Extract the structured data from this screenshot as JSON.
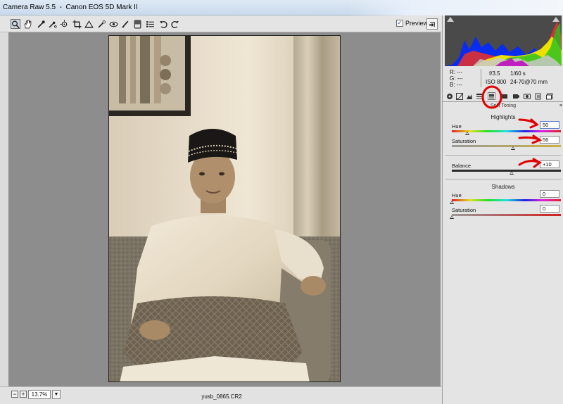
{
  "window": {
    "title": "Camera Raw 5.5  -  Canon EOS 5D Mark II"
  },
  "toolbar": {
    "tools": [
      {
        "name": "zoom-tool-icon",
        "active": true
      },
      {
        "name": "hand-tool-icon"
      },
      {
        "name": "white-balance-tool-icon"
      },
      {
        "name": "color-sampler-tool-icon"
      },
      {
        "name": "targeted-adjustment-tool-icon"
      },
      {
        "name": "crop-tool-icon"
      },
      {
        "name": "straighten-tool-icon"
      },
      {
        "name": "spot-removal-tool-icon"
      },
      {
        "name": "red-eye-removal-tool-icon"
      },
      {
        "name": "adjustment-brush-icon"
      },
      {
        "name": "graduated-filter-icon"
      },
      {
        "name": "preferences-icon"
      },
      {
        "name": "rotate-left-icon"
      },
      {
        "name": "rotate-right-icon"
      }
    ],
    "preview_label": "Preview",
    "preview_checked": true
  },
  "bottombar": {
    "zoom_out": "−",
    "zoom_in": "+",
    "zoom_level": "13.7%",
    "filename": "yusb_0865.CR2"
  },
  "readout": {
    "r_label": "R:",
    "r_value": "---",
    "g_label": "G:",
    "g_value": "---",
    "b_label": "B:",
    "b_value": "---",
    "aperture": "f/3.5",
    "shutter": "1/60 s",
    "iso": "ISO 800",
    "lens": "24-70@70 mm"
  },
  "panel": {
    "title": "Split Toning",
    "highlights": {
      "heading": "Highlights",
      "hue_label": "Hue",
      "hue_value": "50",
      "hue_fraction": 0.139,
      "saturation_label": "Saturation",
      "saturation_value": "56",
      "saturation_fraction": 0.56
    },
    "balance": {
      "label": "Balance",
      "value": "+10",
      "fraction": 0.55
    },
    "shadows": {
      "heading": "Shadows",
      "hue_label": "Hue",
      "hue_value": "0",
      "hue_fraction": 0,
      "saturation_label": "Saturation",
      "saturation_value": "0",
      "saturation_fraction": 0
    }
  },
  "colors": {
    "canvas_bg": "#8d8d8d",
    "annotation_red": "#e00000",
    "panel_bg": "#e4e4e4"
  }
}
